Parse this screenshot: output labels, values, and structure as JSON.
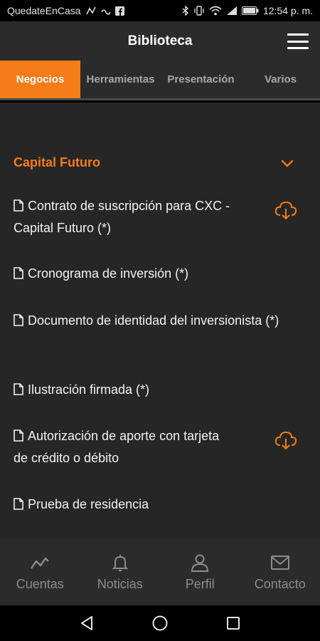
{
  "status_bar": {
    "carrier": "QuedateEnCasa",
    "time": "12:54 p. m."
  },
  "header": {
    "title": "Biblioteca"
  },
  "tabs": [
    {
      "label": "Negocios",
      "active": true
    },
    {
      "label": "Herramientas",
      "active": false
    },
    {
      "label": "Presentación",
      "active": false
    },
    {
      "label": "Varios",
      "active": false
    }
  ],
  "section": {
    "title": "Capital Futuro",
    "documents": [
      {
        "title": "Contrato de suscripción para CXC - Capital Futuro (*)",
        "downloadable": true
      },
      {
        "title": "Cronograma de inversión (*)",
        "downloadable": false
      },
      {
        "title": "Documento de identidad del inversionista (*)",
        "downloadable": false
      },
      {
        "title": "Ilustración firmada (*)",
        "downloadable": false
      },
      {
        "title": "Autorización de aporte con tarjeta de crédito o débito",
        "downloadable": true
      },
      {
        "title": "Prueba de residencia",
        "downloadable": false
      }
    ]
  },
  "bottom_nav": [
    {
      "label": "Cuentas",
      "icon": "chart-icon"
    },
    {
      "label": "Noticias",
      "icon": "bell-icon"
    },
    {
      "label": "Perfil",
      "icon": "person-icon"
    },
    {
      "label": "Contacto",
      "icon": "mail-icon"
    }
  ],
  "colors": {
    "accent": "#f57c18",
    "background": "#262626",
    "header": "#2b2b2b"
  }
}
